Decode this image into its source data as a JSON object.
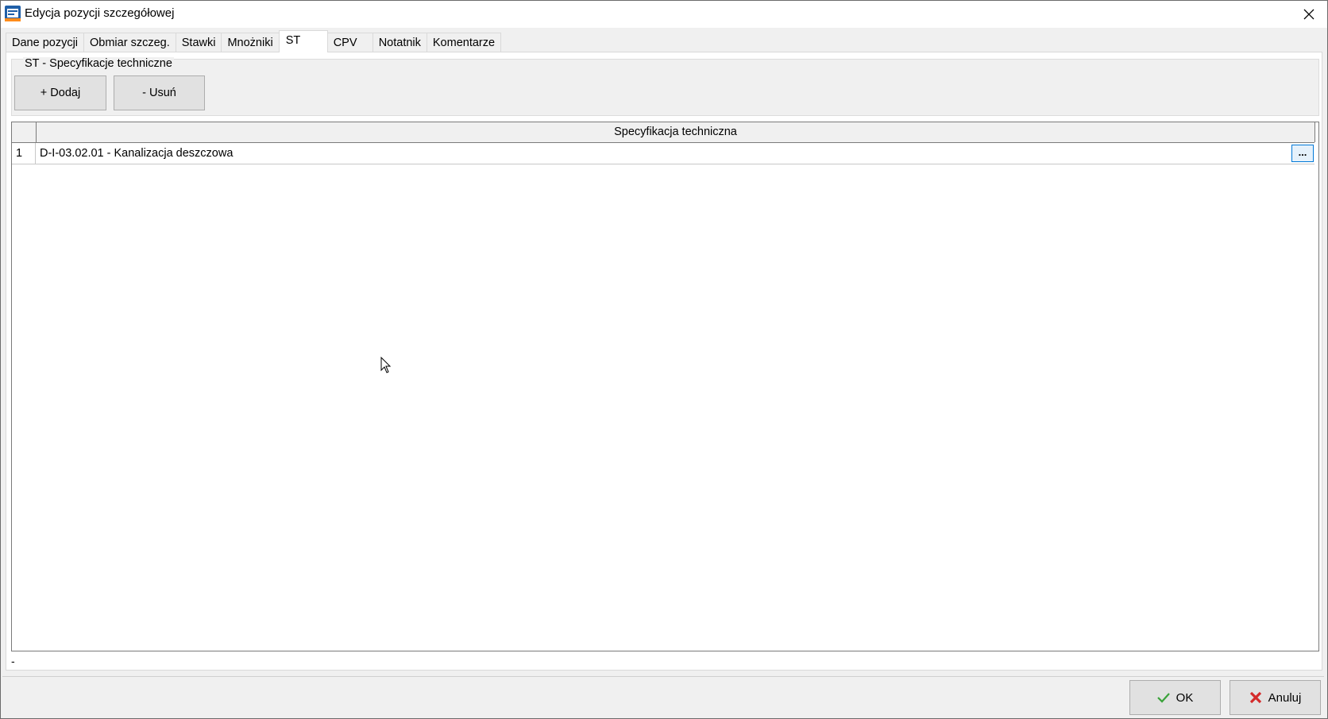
{
  "window": {
    "title": "Edycja pozycji szczegółowej"
  },
  "tabs": [
    {
      "label": "Dane pozycji",
      "active": false
    },
    {
      "label": "Obmiar szczeg.",
      "active": false
    },
    {
      "label": "Stawki",
      "active": false
    },
    {
      "label": "Mnożniki",
      "active": false
    },
    {
      "label": "ST",
      "active": true
    },
    {
      "label": "CPV",
      "active": false
    },
    {
      "label": "Notatnik",
      "active": false
    },
    {
      "label": "Komentarze",
      "active": false
    }
  ],
  "group": {
    "title": "ST - Specyfikacje techniczne",
    "add_label": "+ Dodaj",
    "remove_label": "- Usuń"
  },
  "grid": {
    "column_header": "Specyfikacja techniczna",
    "rows": [
      {
        "num": "1",
        "spec": "D-I-03.02.01 - Kanalizacja deszczowa",
        "button": "..."
      }
    ]
  },
  "status": "-",
  "footer": {
    "ok_label": "OK",
    "cancel_label": "Anuluj"
  },
  "colors": {
    "ok_check": "#3aa23a",
    "cancel_x": "#d42a2a",
    "selection_border": "#0078d7"
  }
}
